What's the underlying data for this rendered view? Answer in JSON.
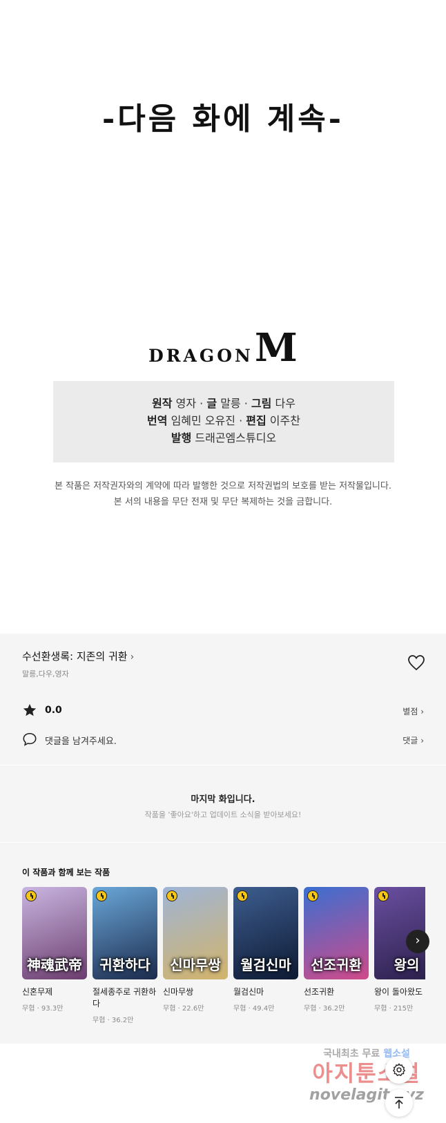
{
  "comic": {
    "next_episode_text": "-다음 화에 계속-",
    "logo_text": "DRAGON",
    "logo_mark": "M",
    "credits": {
      "line1": [
        {
          "label": "원작",
          "value": "영자"
        },
        {
          "label": "글",
          "value": "말릉"
        },
        {
          "label": "그림",
          "value": "다우"
        }
      ],
      "line2": [
        {
          "label": "번역",
          "value": "임혜민 오유진"
        },
        {
          "label": "편집",
          "value": "이주찬"
        }
      ],
      "line3": [
        {
          "label": "발행",
          "value": "드래곤엠스튜디오"
        }
      ],
      "separator": "·"
    },
    "copyright_line1": "본 작품은 저작권자와의 계약에 따라 발행한 것으로 저작권법의 보호를 받는 저작물입니다.",
    "copyright_line2": "본 서의 내용을 무단 전재 및 무단 복제하는 것을 금합니다."
  },
  "info": {
    "title": "수선환생록: 지존의 귀환",
    "title_chevron": "›",
    "authors": "말릉,다우,영자",
    "rating": "0.0",
    "rate_link": "별점 ›",
    "comment_placeholder": "댓글을 남겨주세요.",
    "comment_link": "댓글 ›"
  },
  "last_episode": {
    "title": "마지막 화입니다.",
    "subtitle": "작품을 '좋아요'하고 업데이트 소식을 받아보세요!"
  },
  "related": {
    "heading": "이 작품과 함께 보는 작품",
    "items": [
      {
        "name": "신혼무제",
        "meta": "무협 · 93.3만",
        "art": "神魂武帝",
        "color1": "#c9b6e0",
        "color2": "#6b3c6e"
      },
      {
        "name": "절세종주로 귀환하다",
        "meta": "무협 · 36.2만",
        "art": "귀환하다",
        "color1": "#6aa7d8",
        "color2": "#1c2b4d"
      },
      {
        "name": "신마무쌍",
        "meta": "무협 · 22.6만",
        "art": "신마무쌍",
        "color1": "#9fb5d6",
        "color2": "#d2b36a"
      },
      {
        "name": "월검신마",
        "meta": "무협 · 49.4만",
        "art": "월검신마",
        "color1": "#3d5d8f",
        "color2": "#0e1a33"
      },
      {
        "name": "선조귀환",
        "meta": "무협 · 36.2만",
        "art": "선조귀환",
        "color1": "#3b6fd0",
        "color2": "#d04a8a"
      },
      {
        "name": "왕이 돌아왔도",
        "meta": "무협 · 215만",
        "art": "왕의",
        "color1": "#6a4fa0",
        "color2": "#2a1f4a"
      }
    ],
    "next_arrow": "›"
  },
  "watermark": {
    "line1_a": "국내최초 무료",
    "line1_b": "웹소설",
    "line2": "아지툰소설",
    "line3": "novelagit.xyz"
  }
}
